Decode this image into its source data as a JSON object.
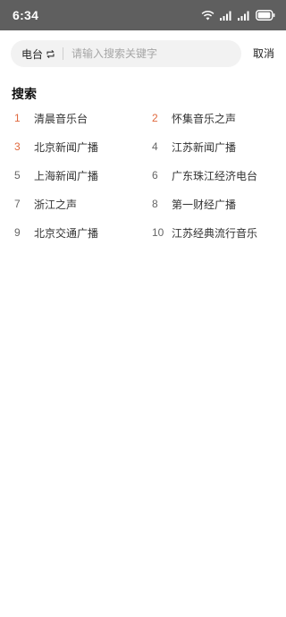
{
  "status_bar": {
    "time": "6:34",
    "icons": [
      "wifi-icon",
      "signal-icon",
      "signal-icon",
      "battery-icon"
    ],
    "battery_level": 0.9
  },
  "search": {
    "channel_label": "电台",
    "channel_icon": "swap-icon",
    "placeholder": "请输入搜索关键字",
    "value": "",
    "cancel_label": "取消"
  },
  "section": {
    "title": "搜索"
  },
  "hot_list": [
    {
      "rank": "1",
      "label": "清晨音乐台"
    },
    {
      "rank": "2",
      "label": "怀集音乐之声"
    },
    {
      "rank": "3",
      "label": "北京新闻广播"
    },
    {
      "rank": "4",
      "label": "江苏新闻广播"
    },
    {
      "rank": "5",
      "label": "上海新闻广播"
    },
    {
      "rank": "6",
      "label": "广东珠江经济电台"
    },
    {
      "rank": "7",
      "label": "浙江之声"
    },
    {
      "rank": "8",
      "label": "第一财经广播"
    },
    {
      "rank": "9",
      "label": "北京交通广播"
    },
    {
      "rank": "10",
      "label": "江苏经典流行音乐"
    }
  ],
  "colors": {
    "status_bar_bg": "#5f5f5f",
    "accent_rank": "#e0693e",
    "search_bg": "#f2f2f2"
  }
}
